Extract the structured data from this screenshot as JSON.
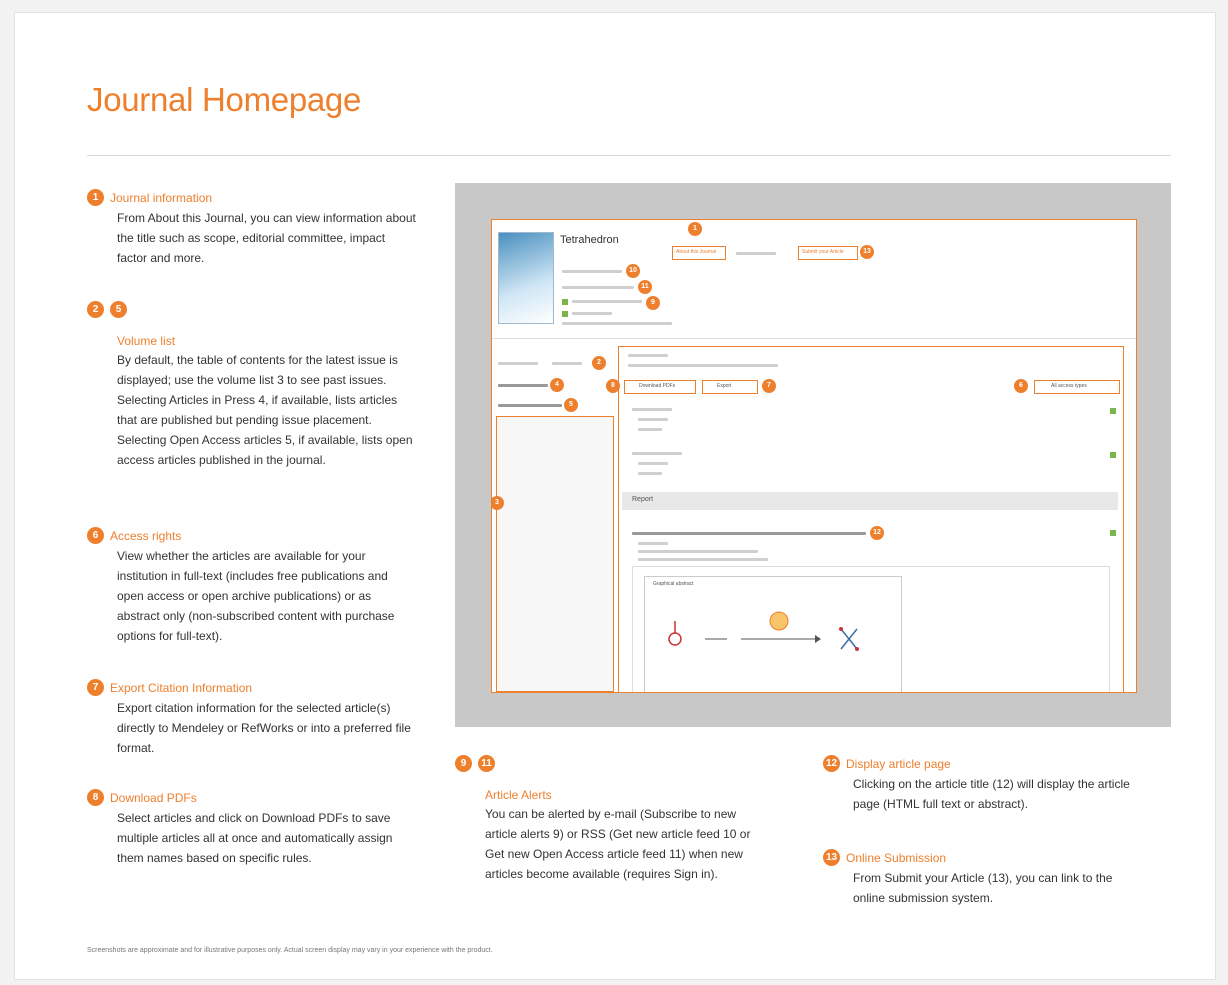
{
  "page_title": "Journal Homepage",
  "left_sections": {
    "journal_info": {
      "number": "1",
      "heading": "Journal information",
      "body": "From About this Journal, you can view information about the title such as scope, editorial committee, impact factor and more."
    },
    "volume_list": {
      "numbers": [
        "2",
        "5"
      ],
      "heading": "Volume list",
      "body": "By default, the table of contents for the latest issue is displayed; use the volume list 3 to see past issues. Selecting Articles in Press 4, if available, lists articles that are published but pending issue placement. Selecting Open Access articles 5, if available, lists open access articles published in the journal."
    },
    "access_rights": {
      "number": "6",
      "heading": "Access rights",
      "body": "View whether the articles are available for your institution in full-text (includes free publications and open access or open archive publications) or as abstract only (non-subscribed content with purchase options for full-text)."
    },
    "export_citation": {
      "number": "7",
      "heading": "Export Citation Information",
      "body": "Export citation information for the selected article(s) directly to Mendeley or RefWorks or into a preferred file format."
    },
    "download_pdfs": {
      "number": "8",
      "heading": "Download PDFs",
      "body": "Select articles and click on Download PDFs to save multiple articles all at once and automatically assign them names based on specific rules."
    }
  },
  "bottom_sections": {
    "article_alerts": {
      "numbers": [
        "9",
        "11"
      ],
      "heading": "Article Alerts",
      "body": "You can be alerted by e-mail (Subscribe to new article alerts 9) or RSS (Get new article feed 10 or Get new Open Access article feed 11) when new articles become available (requires Sign in)."
    },
    "display_article": {
      "number": "12",
      "heading": "Display article page",
      "body": "Clicking on the article title (12) will display the article page (HTML full text or abstract)."
    },
    "online_submission": {
      "number": "13",
      "heading": "Online Submission",
      "body": "From Submit your Article (13), you can link to the online submission system."
    }
  },
  "mock": {
    "journal_name": "Tetrahedron",
    "callouts": [
      "1",
      "13",
      "10",
      "11",
      "9",
      "2",
      "3",
      "4",
      "5",
      "6",
      "7",
      "8",
      "12"
    ],
    "buttons": {
      "about": "About this Journal",
      "submit": "Submit your Article",
      "download": "Download PDFs",
      "export": "Export",
      "all_access": "All access types"
    },
    "section_label": "Report",
    "abstract_label": "Graphical abstract"
  },
  "footnote": "Screenshots are approximate and for illustrative purposes only. Actual screen display may vary in your experience with the product.",
  "colors": {
    "accent": "#ee7f2d",
    "frame": "#c8c8c8",
    "text": "#333333"
  }
}
